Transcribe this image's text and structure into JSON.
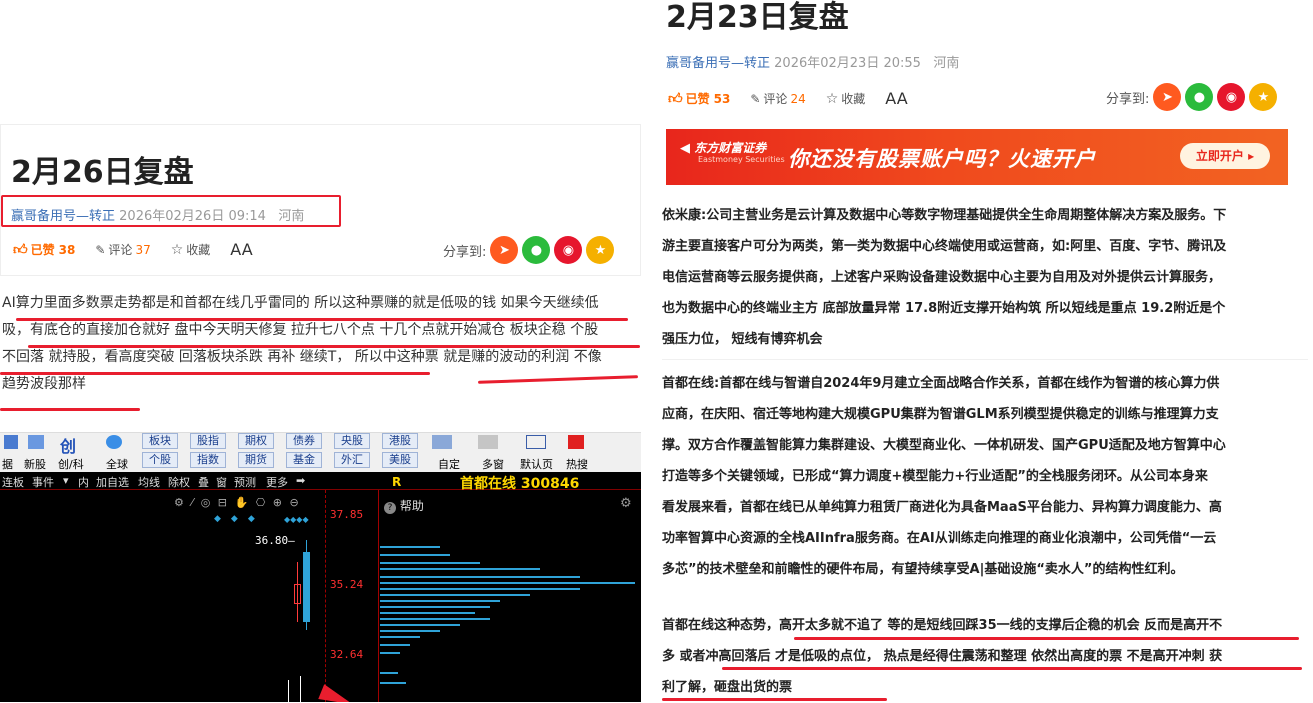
{
  "left_article": {
    "title": "2月26日复盘",
    "author": "赢哥备用号—转正",
    "datetime": "2026年02月26日 09:14",
    "location": "河南",
    "like_label": "已赞",
    "like_count": "38",
    "comment_label": "评论",
    "comment_count": "37",
    "collect_label": "收藏",
    "font_label": "AA",
    "share_label": "分享到:",
    "lines": [
      "AI算力里面多数票走势都是和首都在线几乎雷同的 所以这种票赚的就是低吸的钱 如果今天继续低",
      "吸，有底仓的直接加仓就好 盘中今天明天修复 拉升七八个点 十几个点就开始减仓 板块企稳 个股",
      "不回落 就持股，看高度突破 回落板块杀跌 再补 继续T， 所以中这种票 就是赚的波动的利润 不像",
      "趋势波段那样"
    ]
  },
  "software": {
    "toolbar_tabs": [
      "板块",
      "股指",
      "期权",
      "债券",
      "央股",
      "港股"
    ],
    "toolbar_tabs2": [
      "个股",
      "指数",
      "期货",
      "基金",
      "外汇",
      "美股"
    ],
    "toolbar_left": [
      "据",
      "新股",
      "创/科",
      "全球"
    ],
    "toolbar_right": [
      "自定",
      "多窗",
      "默认页",
      "热搜"
    ],
    "chart_menu": [
      "连板",
      "事件",
      "内",
      "加自选",
      "均线",
      "除权",
      "叠",
      "窗",
      "预测",
      "更多"
    ],
    "prices": [
      "37.85",
      "35.24",
      "32.64"
    ],
    "peak_label": "36.80",
    "help_label": "帮助",
    "r_label": "R",
    "stock_name": "首都在线",
    "stock_code": "300846"
  },
  "right_article": {
    "title": "2月23日复盘",
    "author": "赢哥备用号—转正",
    "datetime": "2026年02月23日 20:55",
    "location": "河南",
    "like_label": "已赞",
    "like_count": "53",
    "comment_label": "评论",
    "comment_count": "24",
    "collect_label": "收藏",
    "font_label": "AA",
    "share_label": "分享到:",
    "banner_logo": "东方财富证券",
    "banner_logo_en": "Eastmoney Securities",
    "banner_text": "你还没有股票账户吗？火速开户",
    "banner_button": "立即开户",
    "para1": [
      "依米康:公司主营业务是云计算及数据中心等数字物理基础提供全生命周期整体解决方案及服务。下",
      "游主要直接客户可分为两类，第一类为数据中心终端使用或运营商，如:阿里、百度、字节、腾讯及",
      "电信运营商等云服务提供商，上述客户采购设备建设数据中心主要为自用及对外提供云计算服务，",
      "也为数据中心的终端业主方 底部放量异常 17.8附近支撑开始构筑 所以短线是重点 19.2附近是个",
      "强压力位， 短线有博弈机会"
    ],
    "para2": [
      "首都在线:首都在线与智谱自2024年9月建立全面战略合作关系，首都在线作为智谱的核心算力供",
      "应商，在庆阳、宿迁等地构建大规模GPU集群为智谱GLM系列模型提供稳定的训练与推理算力支",
      "撑。双方合作覆盖智能算力集群建设、大模型商业化、一体机研发、国产GPU适配及地方智算中心",
      "打造等多个关键领域，已形成“算力调度+模型能力+行业适配”的全栈服务闭环。从公司本身来",
      "看发展来看，首都在线已从单纯算力租赁厂商进化为具备MaaS平台能力、异构算力调度能力、高",
      "功率智算中心资源的全栈AIInfra服务商。在AI从训练走向推理的商业化浪潮中，公司凭借“一云",
      "多芯”的技术壁垒和前瞻性的硬件布局，有望持续享受A|基础设施“卖水人”的结构性红利。"
    ],
    "para3": [
      "首都在线这种态势，高开太多就不追了 等的是短线回踩35一线的支撑后企稳的机会 反而是高开不",
      "多 或者冲高回落后 才是低吸的点位， 热点是经得住震荡和整理 依然出高度的票 不是高开冲刺 获",
      "利了解，砸盘出货的票"
    ]
  },
  "colors": {
    "accent_red": "#e81e2e",
    "link_blue": "#3b6fb6",
    "like_orange": "#ff6a00",
    "chart_bg": "#000000",
    "cyan": "#2fa3d8"
  }
}
